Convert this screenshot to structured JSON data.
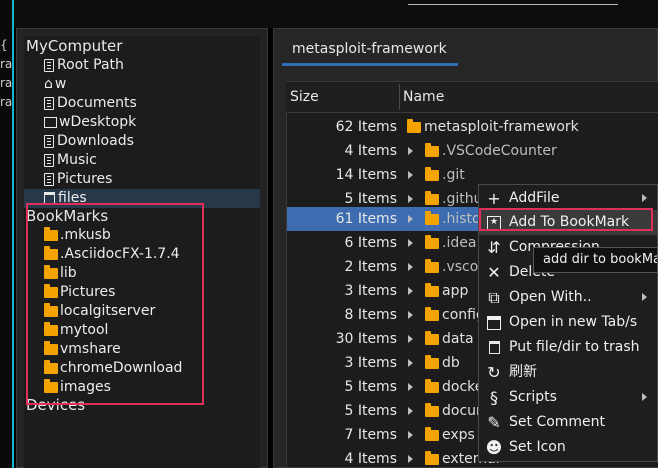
{
  "left_edge": {
    "chars": [
      "{",
      "ra",
      "ra",
      "ra"
    ]
  },
  "left_tree": {
    "mycomputer_header": "MyComputer",
    "mycomputer_items": [
      {
        "label": "Root Path",
        "icon": "file-icon"
      },
      {
        "label": "w",
        "icon": "home-icon"
      },
      {
        "label": "Documents",
        "icon": "file-icon"
      },
      {
        "label": "wDesktopk",
        "icon": "folder-outline-icon"
      },
      {
        "label": "Downloads",
        "icon": "file-icon"
      },
      {
        "label": "Music",
        "icon": "file-icon"
      },
      {
        "label": "Pictures",
        "icon": "file-icon"
      },
      {
        "label": "files",
        "icon": "trash-icon"
      }
    ],
    "bookmarks_header": "BookMarks",
    "bookmarks_items": [
      ".mkusb",
      ".AsciidocFX-1.7.4",
      "lib",
      "Pictures",
      "localgitserver",
      "mytool",
      "vmshare",
      "chromeDownload",
      "images"
    ],
    "devices_header": "Devices"
  },
  "tab": {
    "label": "metasploit-framework"
  },
  "table": {
    "headers": {
      "size": "Size",
      "name": "Name"
    },
    "rows": [
      {
        "size": "62 Items",
        "name": "metasploit-framework"
      },
      {
        "size": "4 Items",
        "name": ".VSCodeCounter"
      },
      {
        "size": "14 Items",
        "name": ".git"
      },
      {
        "size": "5 Items",
        "name": ".github"
      },
      {
        "size": "61 Items",
        "name": ".history"
      },
      {
        "size": "6 Items",
        "name": ".idea"
      },
      {
        "size": "2 Items",
        "name": ".vscode"
      },
      {
        "size": "3 Items",
        "name": "app"
      },
      {
        "size": "8 Items",
        "name": "config"
      },
      {
        "size": "30 Items",
        "name": "data"
      },
      {
        "size": "3 Items",
        "name": "db"
      },
      {
        "size": "5 Items",
        "name": "docker"
      },
      {
        "size": "5 Items",
        "name": "documentation"
      },
      {
        "size": "7 Items",
        "name": "exps"
      },
      {
        "size": "4 Items",
        "name": "external"
      }
    ]
  },
  "context_menu": {
    "items": [
      {
        "label": "AddFile",
        "icon": "plus-icon"
      },
      {
        "label": "Add To BookMark",
        "icon": "bookmark-icon"
      },
      {
        "label": "Compression",
        "icon": "compress-icon"
      },
      {
        "label": "Delete",
        "icon": "x-icon"
      },
      {
        "label": "Open With..",
        "icon": "open-external-icon"
      },
      {
        "label": "Open in new Tab/s",
        "icon": "tab-icon"
      },
      {
        "label": "Put file/dir to trash",
        "icon": "trash-icon"
      },
      {
        "label": "刷新",
        "icon": "refresh-icon"
      },
      {
        "label": "Scripts",
        "icon": "script-icon"
      },
      {
        "label": "Set Comment",
        "icon": "comment-icon"
      },
      {
        "label": "Set Icon",
        "icon": "set-icon-icon"
      }
    ],
    "tooltip": "add dir to bookMark"
  },
  "colors": {
    "accent": "#2e6fb8",
    "selection": "#3d6cb0",
    "highlight_box": "#e0305a",
    "folder": "#f5a300",
    "frame": "#12b7c8"
  }
}
